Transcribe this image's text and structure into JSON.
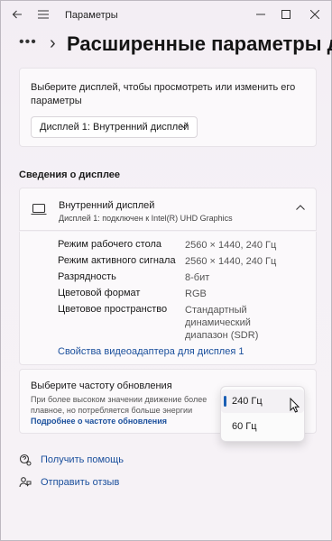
{
  "app": {
    "title": "Параметры",
    "page_title": "Расширенные параметры дисплея",
    "breadcrumb_more": "•••"
  },
  "display_select": {
    "prompt": "Выберите дисплей, чтобы просмотреть или изменить его параметры",
    "selected": "Дисплей 1: Внутренний дисплей"
  },
  "info": {
    "section_title": "Сведения о дисплее",
    "display_name": "Внутренний дисплей",
    "display_sub": "Дисплей 1: подключен к Intel(R) UHD Graphics",
    "properties": [
      {
        "label": "Режим рабочего стола",
        "value": "2560 × 1440, 240 Гц"
      },
      {
        "label": "Режим активного сигнала",
        "value": "2560 × 1440, 240 Гц"
      },
      {
        "label": "Разрядность",
        "value": "8-бит"
      },
      {
        "label": "Цветовой формат",
        "value": "RGB"
      },
      {
        "label": "Цветовое пространство",
        "value": "Стандартный динамический диапазон (SDR)"
      }
    ],
    "adapter_link": "Свойства видеоадаптера для дисплея 1"
  },
  "refresh": {
    "title": "Выберите частоту обновления",
    "description": "При более высоком значении движение более плавное, но потребляется больше энергии",
    "more_link": "Подробнее о частоте обновления",
    "options": [
      "240 Гц",
      "60 Гц"
    ],
    "selected_index": 0
  },
  "footer": {
    "help": "Получить помощь",
    "feedback": "Отправить отзыв"
  },
  "colors": {
    "accent": "#1a5fb4",
    "link": "#1a4f9c"
  }
}
